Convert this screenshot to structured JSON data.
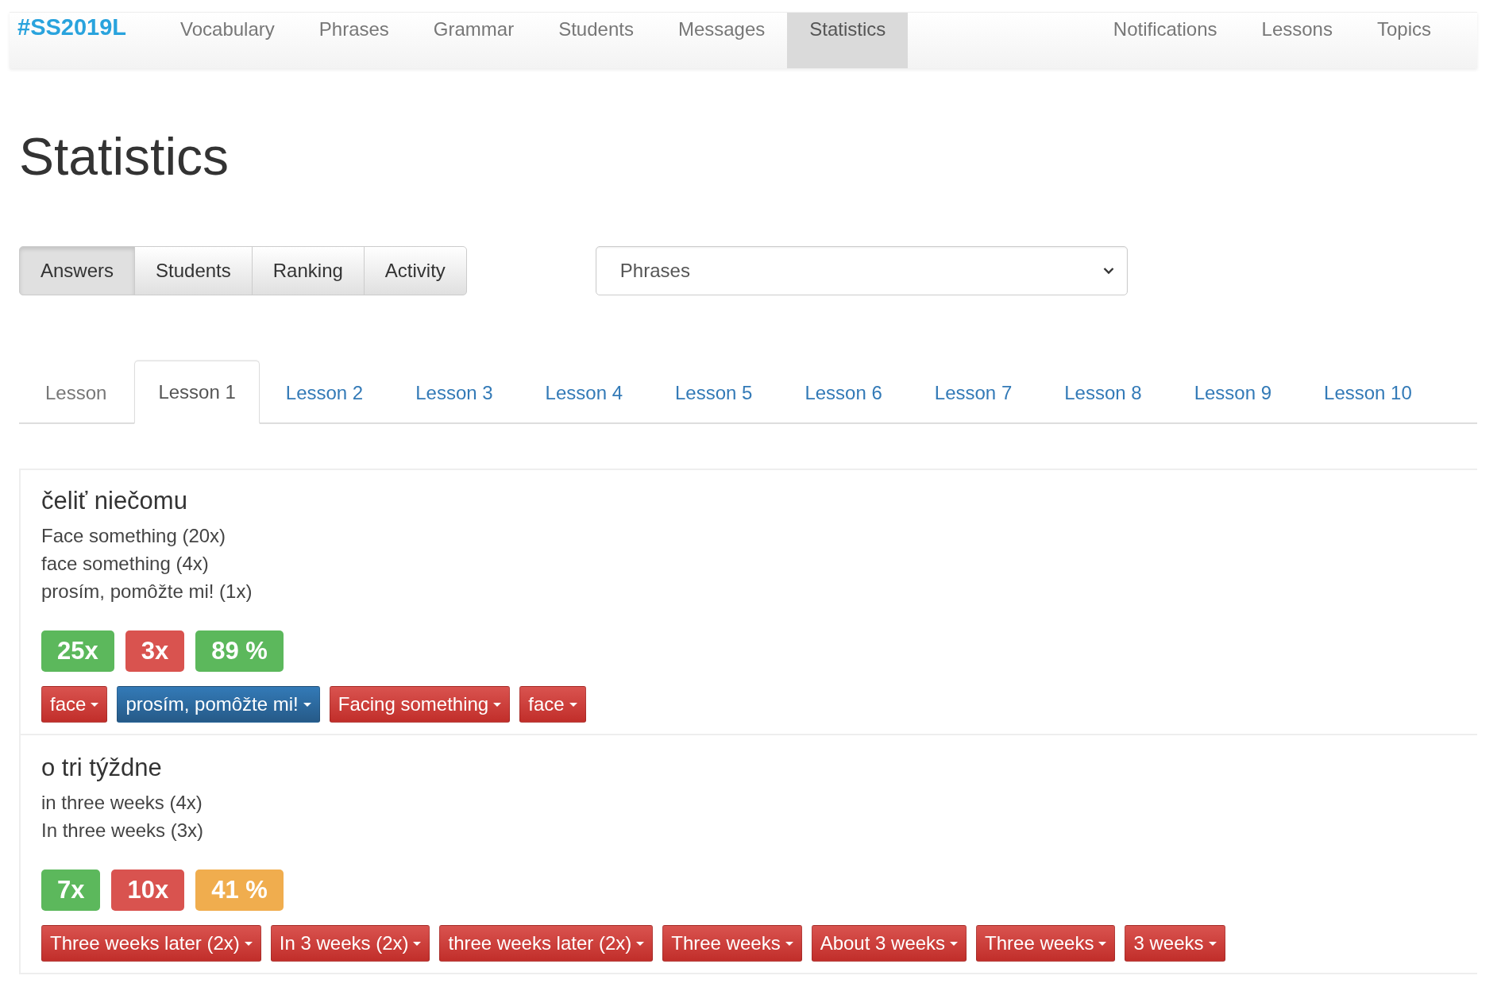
{
  "navbar": {
    "brand": "#SS2019L",
    "items": [
      {
        "label": "Vocabulary",
        "selected": false
      },
      {
        "label": "Phrases",
        "selected": false
      },
      {
        "label": "Grammar",
        "selected": false
      },
      {
        "label": "Students",
        "selected": false
      },
      {
        "label": "Messages",
        "selected": false
      },
      {
        "label": "Statistics",
        "selected": true
      }
    ],
    "right_items": [
      {
        "label": "Notifications",
        "selected": false
      },
      {
        "label": "Lessons",
        "selected": false
      },
      {
        "label": "Topics",
        "selected": false
      }
    ]
  },
  "page_title": "Statistics",
  "view_buttons": [
    {
      "label": "Answers",
      "selected": true
    },
    {
      "label": "Students",
      "selected": false
    },
    {
      "label": "Ranking",
      "selected": false
    },
    {
      "label": "Activity",
      "selected": false
    }
  ],
  "category_select": {
    "value": "Phrases"
  },
  "lesson_tabs": [
    {
      "label": "Lesson",
      "kind": "label"
    },
    {
      "label": "Lesson 1",
      "kind": "tab",
      "selected": true
    },
    {
      "label": "Lesson 2",
      "kind": "tab",
      "selected": false
    },
    {
      "label": "Lesson 3",
      "kind": "tab",
      "selected": false
    },
    {
      "label": "Lesson 4",
      "kind": "tab",
      "selected": false
    },
    {
      "label": "Lesson 5",
      "kind": "tab",
      "selected": false
    },
    {
      "label": "Lesson 6",
      "kind": "tab",
      "selected": false
    },
    {
      "label": "Lesson 7",
      "kind": "tab",
      "selected": false
    },
    {
      "label": "Lesson 8",
      "kind": "tab",
      "selected": false
    },
    {
      "label": "Lesson 9",
      "kind": "tab",
      "selected": false
    },
    {
      "label": "Lesson 10",
      "kind": "tab",
      "selected": false
    }
  ],
  "phrases": [
    {
      "phrase": "čeliť niečomu",
      "correct_answers": [
        "Face something (20x)",
        "face something (4x)",
        "prosím, pomôžte mi! (1x)"
      ],
      "stats": [
        {
          "text": "25x",
          "kind": "success"
        },
        {
          "text": "3x",
          "kind": "danger"
        },
        {
          "text": "89 %",
          "kind": "success"
        }
      ],
      "wrong_answers": [
        {
          "text": "face",
          "kind": "danger"
        },
        {
          "text": "prosím, pomôžte mi!",
          "kind": "primary"
        },
        {
          "text": "Facing something",
          "kind": "danger"
        },
        {
          "text": "face",
          "kind": "danger"
        }
      ]
    },
    {
      "phrase": "o tri týždne",
      "correct_answers": [
        "in three weeks (4x)",
        "In three weeks (3x)"
      ],
      "stats": [
        {
          "text": "7x",
          "kind": "success"
        },
        {
          "text": "10x",
          "kind": "danger"
        },
        {
          "text": "41 %",
          "kind": "warning"
        }
      ],
      "wrong_answers": [
        {
          "text": "Three weeks later (2x)",
          "kind": "danger"
        },
        {
          "text": "In 3 weeks (2x)",
          "kind": "danger"
        },
        {
          "text": "three weeks later (2x)",
          "kind": "danger"
        },
        {
          "text": "Three weeks",
          "kind": "danger"
        },
        {
          "text": "About 3 weeks",
          "kind": "danger"
        },
        {
          "text": "Three weeks",
          "kind": "danger"
        },
        {
          "text": "3 weeks",
          "kind": "danger"
        }
      ]
    }
  ]
}
